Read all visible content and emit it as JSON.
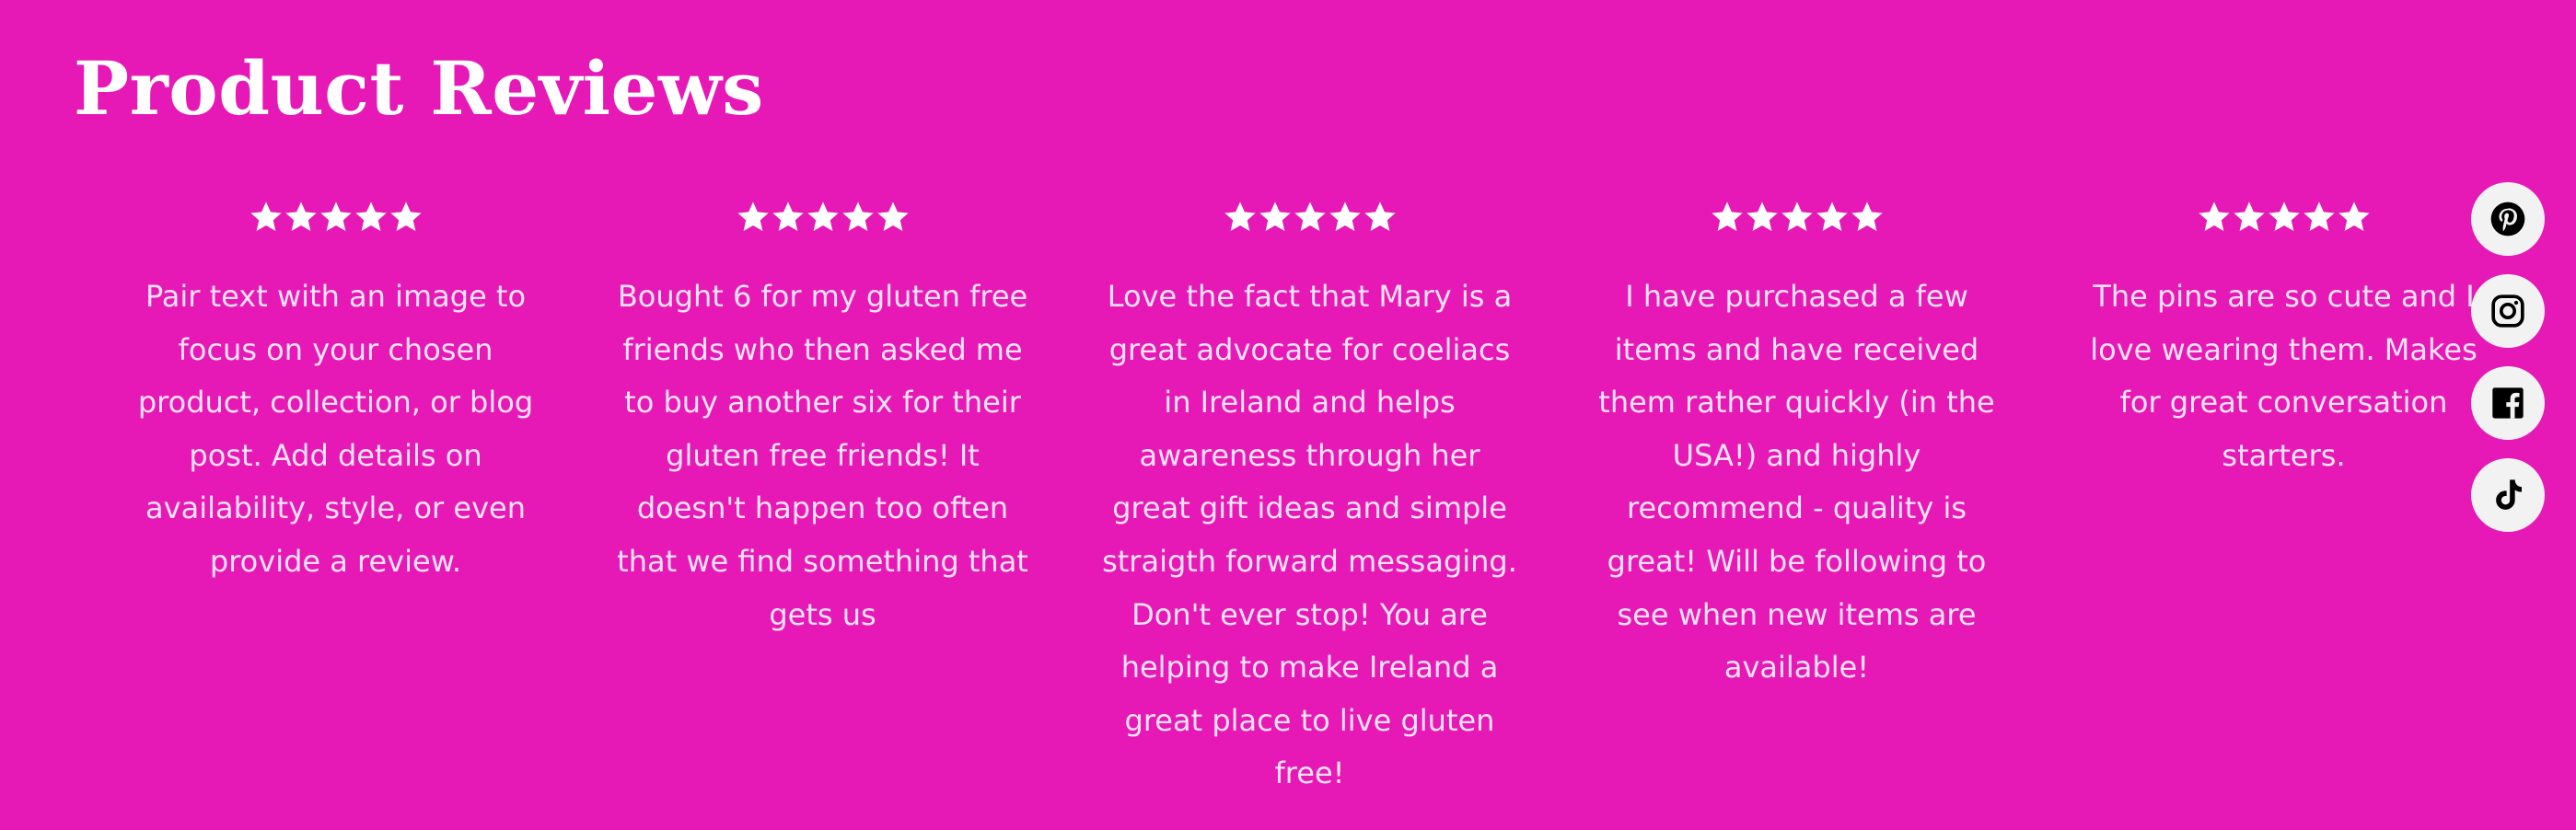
{
  "section": {
    "title": "Product Reviews"
  },
  "reviews": [
    {
      "rating": 5,
      "text": "Pair text with an image to\nfocus on your chosen\nproduct, collection, or blog\npost. Add details on\navailability, style, or even\nprovide a review."
    },
    {
      "rating": 5,
      "text": "Bought 6 for my gluten free\nfriends who then asked me\nto buy another six for their\ngluten free friends! It\ndoesn't happen too often\nthat we find something that\ngets us"
    },
    {
      "rating": 5,
      "text": "Love the fact that Mary is a\ngreat advocate for coeliacs\nin Ireland and helps\nawareness through her\ngreat gift ideas and simple\nstraigth forward messaging.\nDon't ever stop! You are\nhelping to make Ireland a\ngreat place to live gluten\nfree!"
    },
    {
      "rating": 5,
      "text": "I have purchased a few\nitems and have received\nthem rather quickly (in the\nUSA!) and highly\nrecommend - quality is\ngreat! Will be following to\nsee when new items are\navailable!"
    },
    {
      "rating": 5,
      "text": "The pins are so cute and I\nlove wearing them. Makes\nfor great conversation\nstarters."
    }
  ],
  "social_links": [
    {
      "icon": "pinterest-icon"
    },
    {
      "icon": "instagram-icon"
    },
    {
      "icon": "facebook-icon"
    },
    {
      "icon": "tiktok-icon"
    }
  ],
  "colors": {
    "background": "#e619b7",
    "title": "#ffffff",
    "review_text": "#fbe3f5",
    "star": "#ffffff",
    "social_button_bg": "#f2f2f2",
    "social_icon": "#000000"
  }
}
